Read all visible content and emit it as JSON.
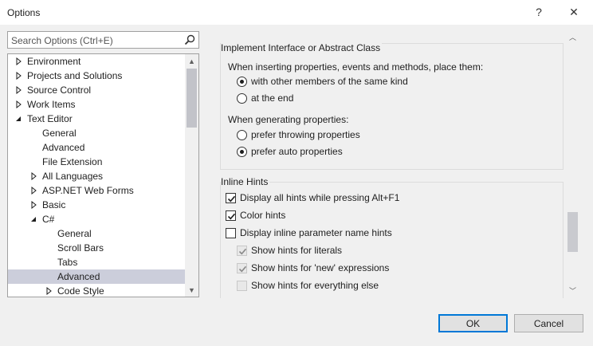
{
  "window": {
    "title": "Options",
    "help_glyph": "?",
    "close_glyph": "✕"
  },
  "search": {
    "placeholder": "Search Options (Ctrl+E)",
    "icon": "search-icon"
  },
  "tree": {
    "items": [
      {
        "label": "Environment",
        "arrow": "collapsed",
        "selected": false
      },
      {
        "label": "Projects and Solutions",
        "arrow": "collapsed",
        "selected": false
      },
      {
        "label": "Source Control",
        "arrow": "collapsed",
        "selected": false
      },
      {
        "label": "Work Items",
        "arrow": "collapsed",
        "selected": false
      },
      {
        "label": "Text Editor",
        "arrow": "expanded",
        "selected": false
      },
      {
        "label": "General",
        "arrow": "none",
        "selected": false
      },
      {
        "label": "Advanced",
        "arrow": "none",
        "selected": false
      },
      {
        "label": "File Extension",
        "arrow": "none",
        "selected": false
      },
      {
        "label": "All Languages",
        "arrow": "collapsed",
        "selected": false
      },
      {
        "label": "ASP.NET Web Forms",
        "arrow": "collapsed",
        "selected": false
      },
      {
        "label": "Basic",
        "arrow": "collapsed",
        "selected": false
      },
      {
        "label": "C#",
        "arrow": "expanded",
        "selected": false
      },
      {
        "label": "General",
        "arrow": "none",
        "selected": false
      },
      {
        "label": "Scroll Bars",
        "arrow": "none",
        "selected": false
      },
      {
        "label": "Tabs",
        "arrow": "none",
        "selected": false
      },
      {
        "label": "Advanced",
        "arrow": "none",
        "selected": true
      },
      {
        "label": "Code Style",
        "arrow": "collapsed",
        "selected": false
      }
    ]
  },
  "implement_interface": {
    "title": "Implement Interface or Abstract Class",
    "placement_prompt": "When inserting properties, events and methods, place them:",
    "placement_options": [
      {
        "label": "with other members of the same kind",
        "selected": true
      },
      {
        "label": "at the end",
        "selected": false
      }
    ],
    "generation_prompt": "When generating properties:",
    "generation_options": [
      {
        "label": "prefer throwing properties",
        "selected": false
      },
      {
        "label": "prefer auto properties",
        "selected": true
      }
    ]
  },
  "inline_hints": {
    "title": "Inline Hints",
    "options": [
      {
        "label": "Display all hints while pressing Alt+F1",
        "checked": true,
        "disabled": false
      },
      {
        "label": "Color hints",
        "checked": true,
        "disabled": false
      },
      {
        "label": "Display inline parameter name hints",
        "checked": false,
        "disabled": false
      },
      {
        "label": "Show hints for literals",
        "checked": true,
        "disabled": true
      },
      {
        "label": "Show hints for 'new' expressions",
        "checked": true,
        "disabled": true
      },
      {
        "label": "Show hints for everything else",
        "checked": false,
        "disabled": true
      }
    ]
  },
  "footer": {
    "ok_label": "OK",
    "cancel_label": "Cancel"
  },
  "colors": {
    "accent": "#0078d7",
    "selection": "#cccedb",
    "scroll_thumb": "#c2c3c9"
  }
}
